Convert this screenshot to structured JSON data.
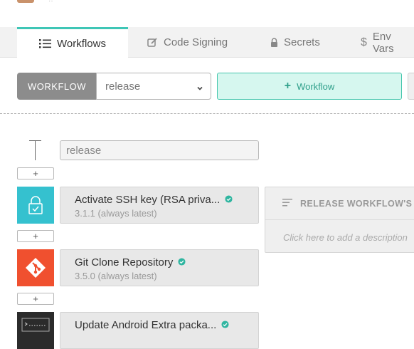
{
  "tabs": [
    {
      "label": "Workflows",
      "icon": "list-icon",
      "active": true
    },
    {
      "label": "Code Signing",
      "icon": "edit-icon"
    },
    {
      "label": "Secrets",
      "icon": "lock-icon"
    },
    {
      "label": "Env Vars",
      "icon": "dollar-icon"
    }
  ],
  "workflow_bar": {
    "label": "WORKFLOW",
    "selected": "release",
    "add_button": "Workflow"
  },
  "workflow_name": {
    "value": "release"
  },
  "add_step_label": "+",
  "steps": [
    {
      "title": "Activate SSH key (RSA priva...",
      "version": "3.1.1 (always latest)",
      "icon": "ssh-lock-icon",
      "icon_color": "#35c1cf",
      "verified": true
    },
    {
      "title": "Git Clone Repository",
      "version": "3.5.0 (always latest)",
      "icon": "git-icon",
      "icon_color": "#f0502f",
      "verified": true
    },
    {
      "title": "Update Android Extra packa...",
      "version": "",
      "icon": "terminal-icon",
      "icon_color": "#2b2b2b",
      "verified": true
    }
  ],
  "description_panel": {
    "title": "RELEASE WORKFLOW'S",
    "placeholder": "Click here to add a description"
  },
  "colors": {
    "accent": "#3ec6b6",
    "add_button_bg": "#d6f7ef",
    "verified": "#2fb5a0"
  }
}
